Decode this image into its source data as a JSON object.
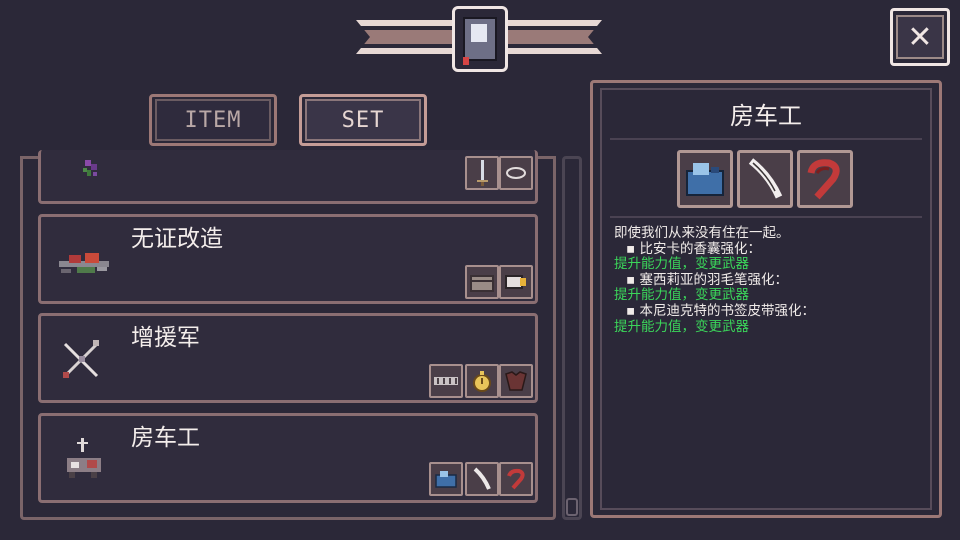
{
  "header": {
    "icon": "journal-book-icon",
    "close_icon": "close-x-icon",
    "close_label": "✕"
  },
  "tabs": [
    {
      "label": "ITEM",
      "active": false
    },
    {
      "label": "SET",
      "active": true
    }
  ],
  "sets": [
    {
      "name": "",
      "art_icon": "flower-vine-set-icon",
      "pieces": [
        "sword-icon",
        "bracelet-icon"
      ]
    },
    {
      "name": "无证改造",
      "art_icon": "gadget-set-icon",
      "pieces": [
        "chest-icon",
        "camera-icon"
      ]
    },
    {
      "name": "增援军",
      "art_icon": "crossed-arrows-set-icon",
      "pieces": [
        "ammo-belt-icon",
        "pocket-watch-icon",
        "armor-icon"
      ]
    },
    {
      "name": "房车工",
      "art_icon": "caravan-set-icon",
      "pieces": [
        "sachet-icon",
        "feather-quill-icon",
        "bookmark-ribbon-icon"
      ]
    }
  ],
  "detail": {
    "title": "房车工",
    "pieces": [
      "sachet-icon",
      "feather-quill-icon",
      "bookmark-ribbon-icon"
    ],
    "lines": [
      {
        "text": "即使我们从来没有住在一起。",
        "kind": "w",
        "bullet": false
      },
      {
        "text": "▪ 比安卡的香囊强化：",
        "kind": "w",
        "bullet": true
      },
      {
        "text": "提升能力值，变更武器",
        "kind": "g",
        "bullet": false
      },
      {
        "text": "▪ 塞西莉亚的羽毛笔强化：",
        "kind": "w",
        "bullet": true
      },
      {
        "text": "提升能力值，变更武器",
        "kind": "g",
        "bullet": false
      },
      {
        "text": "▪ 本尼迪克特的书签皮带强化：",
        "kind": "w",
        "bullet": true
      },
      {
        "text": "提升能力值，变更武器",
        "kind": "g",
        "bullet": false
      }
    ]
  },
  "colors": {
    "background": "#2b2838",
    "frame": "#9c7876",
    "highlight_text": "#3bd65a"
  }
}
